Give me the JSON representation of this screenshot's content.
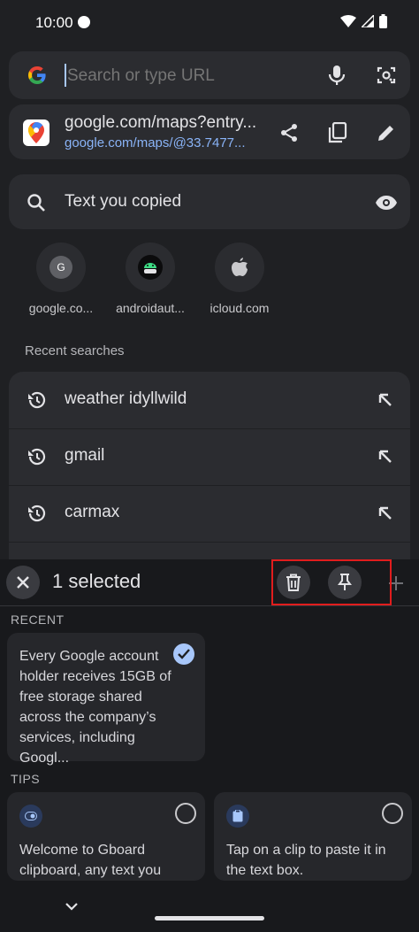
{
  "status_bar": {
    "time": "10:00"
  },
  "omnibox": {
    "placeholder": "Search or type URL"
  },
  "current_page": {
    "title": "google.com/maps?entry...",
    "url": "google.com/maps/@33.7477..."
  },
  "clipboard_suggestion": {
    "label": "Text you copied"
  },
  "shortcuts": [
    {
      "label": "google.co...",
      "letter": "G"
    },
    {
      "label": "androidaut..."
    },
    {
      "label": "icloud.com"
    }
  ],
  "recent": {
    "title": "Recent searches",
    "items": [
      "weather idyllwild",
      "gmail",
      "carmax"
    ]
  },
  "clipboard_panel": {
    "selected_text": "1 selected",
    "recent_label": "RECENT",
    "recent_clip": "Every Google account holder receives 15GB of free storage shared across the company’s services, including Googl...",
    "tips_label": "TIPS",
    "tip1": "Welcome to Gboard clipboard, any text you",
    "tip2": "Tap on a clip to paste it in the text box."
  },
  "colors": {
    "highlight": "#e11d1d",
    "link": "#8ab4f8",
    "accent": "#a8c7fa"
  }
}
